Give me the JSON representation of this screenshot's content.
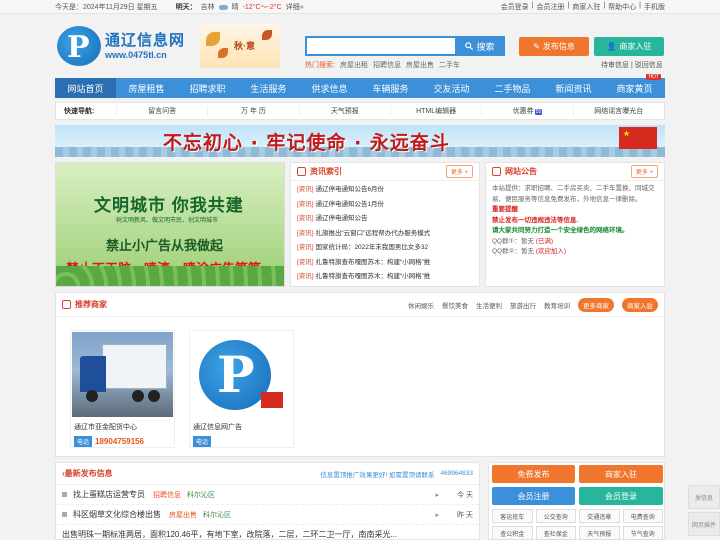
{
  "topbar": {
    "date": "今天是：2024年11月29日 星期五",
    "weather_label": "明天：",
    "city": "吉林",
    "condition": "晴",
    "temp": "-12°C～-2°C",
    "detail": "详细»",
    "links": [
      "会员登录",
      "|",
      "会员注册",
      "|",
      "商家入驻",
      "|",
      "帮助中心",
      "|",
      "手机版"
    ]
  },
  "logo": {
    "name": "通辽信息网",
    "domain": "www.0475tl.cn",
    "emblem_char": "P"
  },
  "autumn_banner": {
    "text": "秋·意"
  },
  "search": {
    "placeholder": "",
    "button": "搜索",
    "hot_label": "热门搜索:",
    "hot_links": [
      "房屋出租",
      "招聘信息",
      "房屋出售",
      "二手车"
    ]
  },
  "actions": {
    "publish": "发布信息",
    "join": "商家入驻",
    "pending": "待审信息",
    "sep": "|",
    "rejected": "驳回信息"
  },
  "nav": {
    "items": [
      "网站首页",
      "房屋租售",
      "招聘求职",
      "生活服务",
      "供求信息",
      "车辆服务",
      "交友活动",
      "二手物品",
      "新闻资讯",
      "商家黄页"
    ],
    "hot_tag": "HOT"
  },
  "quick": {
    "label": "快速导航:",
    "items": [
      "留言问答",
      "万 年 历",
      "天气预报",
      "HTML编辑器",
      "优惠券",
      "网络谣言曝光台"
    ],
    "coupon_badge": "55"
  },
  "slogan": {
    "text": "不忘初心 · 牢记使命 · 永远奋斗"
  },
  "poster": {
    "title": "文明城市 你我共建",
    "sub": "树文明新风、做文明市民、创文明城市",
    "line2": "禁止小广告从我做起",
    "overlay": "禁止不干胶、喷漆、喷涂广告等等"
  },
  "news": {
    "title": "资讯索引",
    "more": "更多 +",
    "items": [
      {
        "tag": "[资讯]",
        "text": "通辽停电通知公告6月份"
      },
      {
        "tag": "[资讯]",
        "text": "通辽停电通知公告1月份"
      },
      {
        "tag": "[资讯]",
        "text": "通辽停电通知公告"
      },
      {
        "tag": "[资讯]",
        "text": "扎旗推出“云窗口”远程帮办代办服务模式"
      },
      {
        "tag": "[资讯]",
        "text": "国家统计局：2022年末我国男比女多32"
      },
      {
        "tag": "[资讯]",
        "text": "扎鲁特旗查布嘎图苏木：构建“小网格”推"
      },
      {
        "tag": "[资讯]",
        "text": "扎鲁特旗查布嘎图苏木：构建“小网格”推"
      }
    ]
  },
  "notice": {
    "title": "网站公告",
    "more": "更多 +",
    "intro": "本站提供：求职招聘、二手房买卖、二手车置换、同城交易、便民服务等信息免费发布，外地信息一律删除。",
    "warn_title": "重要提醒",
    "warn_text": "禁止发布一切违规违法等信息.",
    "slogan": "请大家共同努力打造一个安全绿色的网络环境。",
    "qq1_label": "QQ群①：暂无",
    "qq1_status": "(已满)",
    "qq2_label": "QQ群②：暂无",
    "qq2_status": "(欢迎加入)"
  },
  "merchants": {
    "title": "推荐商家",
    "cats": [
      "休闲娱乐",
      "餐饮美食",
      "生活便利",
      "旅游出行",
      "教育培训"
    ],
    "more": "更多商家",
    "join": "商家入驻",
    "cards": [
      {
        "name": "通辽市亚金配货中心",
        "phone_label": "电话",
        "phone": "18904759156"
      },
      {
        "name": "通辽信息网广告",
        "phone_label": "电话",
        "phone": ""
      }
    ]
  },
  "latest": {
    "title": "最新发布信息",
    "note": "信息置顶推广效果更好! 如需置顶请联系",
    "qq": "469964833",
    "rows": [
      {
        "title": "找上蛋糕店运营专员",
        "cat": "招聘信息",
        "loc": "科尔沁区",
        "day": "今 天"
      },
      {
        "title": "科区烟草文化综合楼出售",
        "cat": "房屋出售",
        "loc": "科尔沁区",
        "day": "昨 天"
      },
      {
        "title": "出售明珠一期标准两居，面积120.46平，有地下室，改院落，二层，二环二卫一厅，南南采光...",
        "cat": "",
        "loc": "",
        "day": ""
      }
    ]
  },
  "sidepanel": {
    "publish": "免费发布",
    "join": "商家入驻",
    "register": "会员注册",
    "login": "会员登录",
    "grid": [
      "客运班车",
      "公交查询",
      "交通违章",
      "电费查询",
      "查公积金",
      "查社保金",
      "天气预报",
      "节气查询"
    ]
  },
  "rail": {
    "publish": "发信息",
    "plugin": "网页插件"
  },
  "colors": {
    "primary": "#3c8fd9",
    "orange": "#f1762d",
    "teal": "#27b69b",
    "red": "#d6432c"
  }
}
